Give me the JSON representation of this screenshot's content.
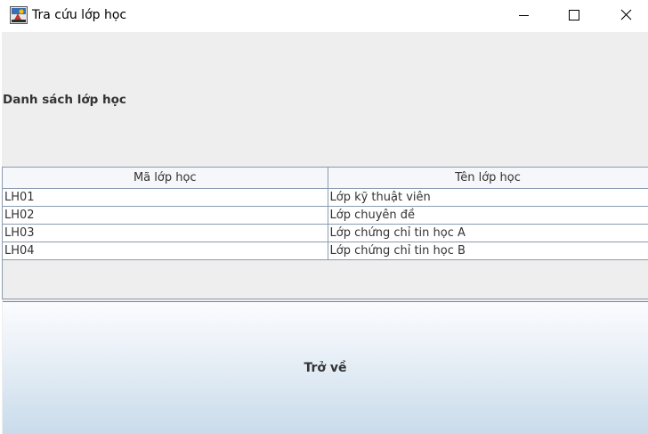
{
  "window": {
    "title": "Tra cứu lớp học",
    "icon": "java-app-icon",
    "controls": [
      "minimize-icon",
      "maximize-icon",
      "close-icon"
    ]
  },
  "content": {
    "heading": "Danh sách lớp học",
    "table": {
      "columns": [
        "Mã lớp học",
        "Tên lớp học"
      ],
      "rows": [
        [
          "LH01",
          "Lớp kỹ thuật viên"
        ],
        [
          "LH02",
          "Lớp chuyên đề"
        ],
        [
          "LH03",
          "Lớp chứng chỉ tin học A"
        ],
        [
          "LH04",
          "Lớp chứng chỉ tin học B"
        ]
      ]
    },
    "back_button": "Trở về"
  },
  "colors": {
    "panel": "#eeeeee",
    "grid_line": "#8b9bb1",
    "button_gradient_top": "#fbfcfe",
    "button_gradient_bottom": "#c9dbeb"
  }
}
